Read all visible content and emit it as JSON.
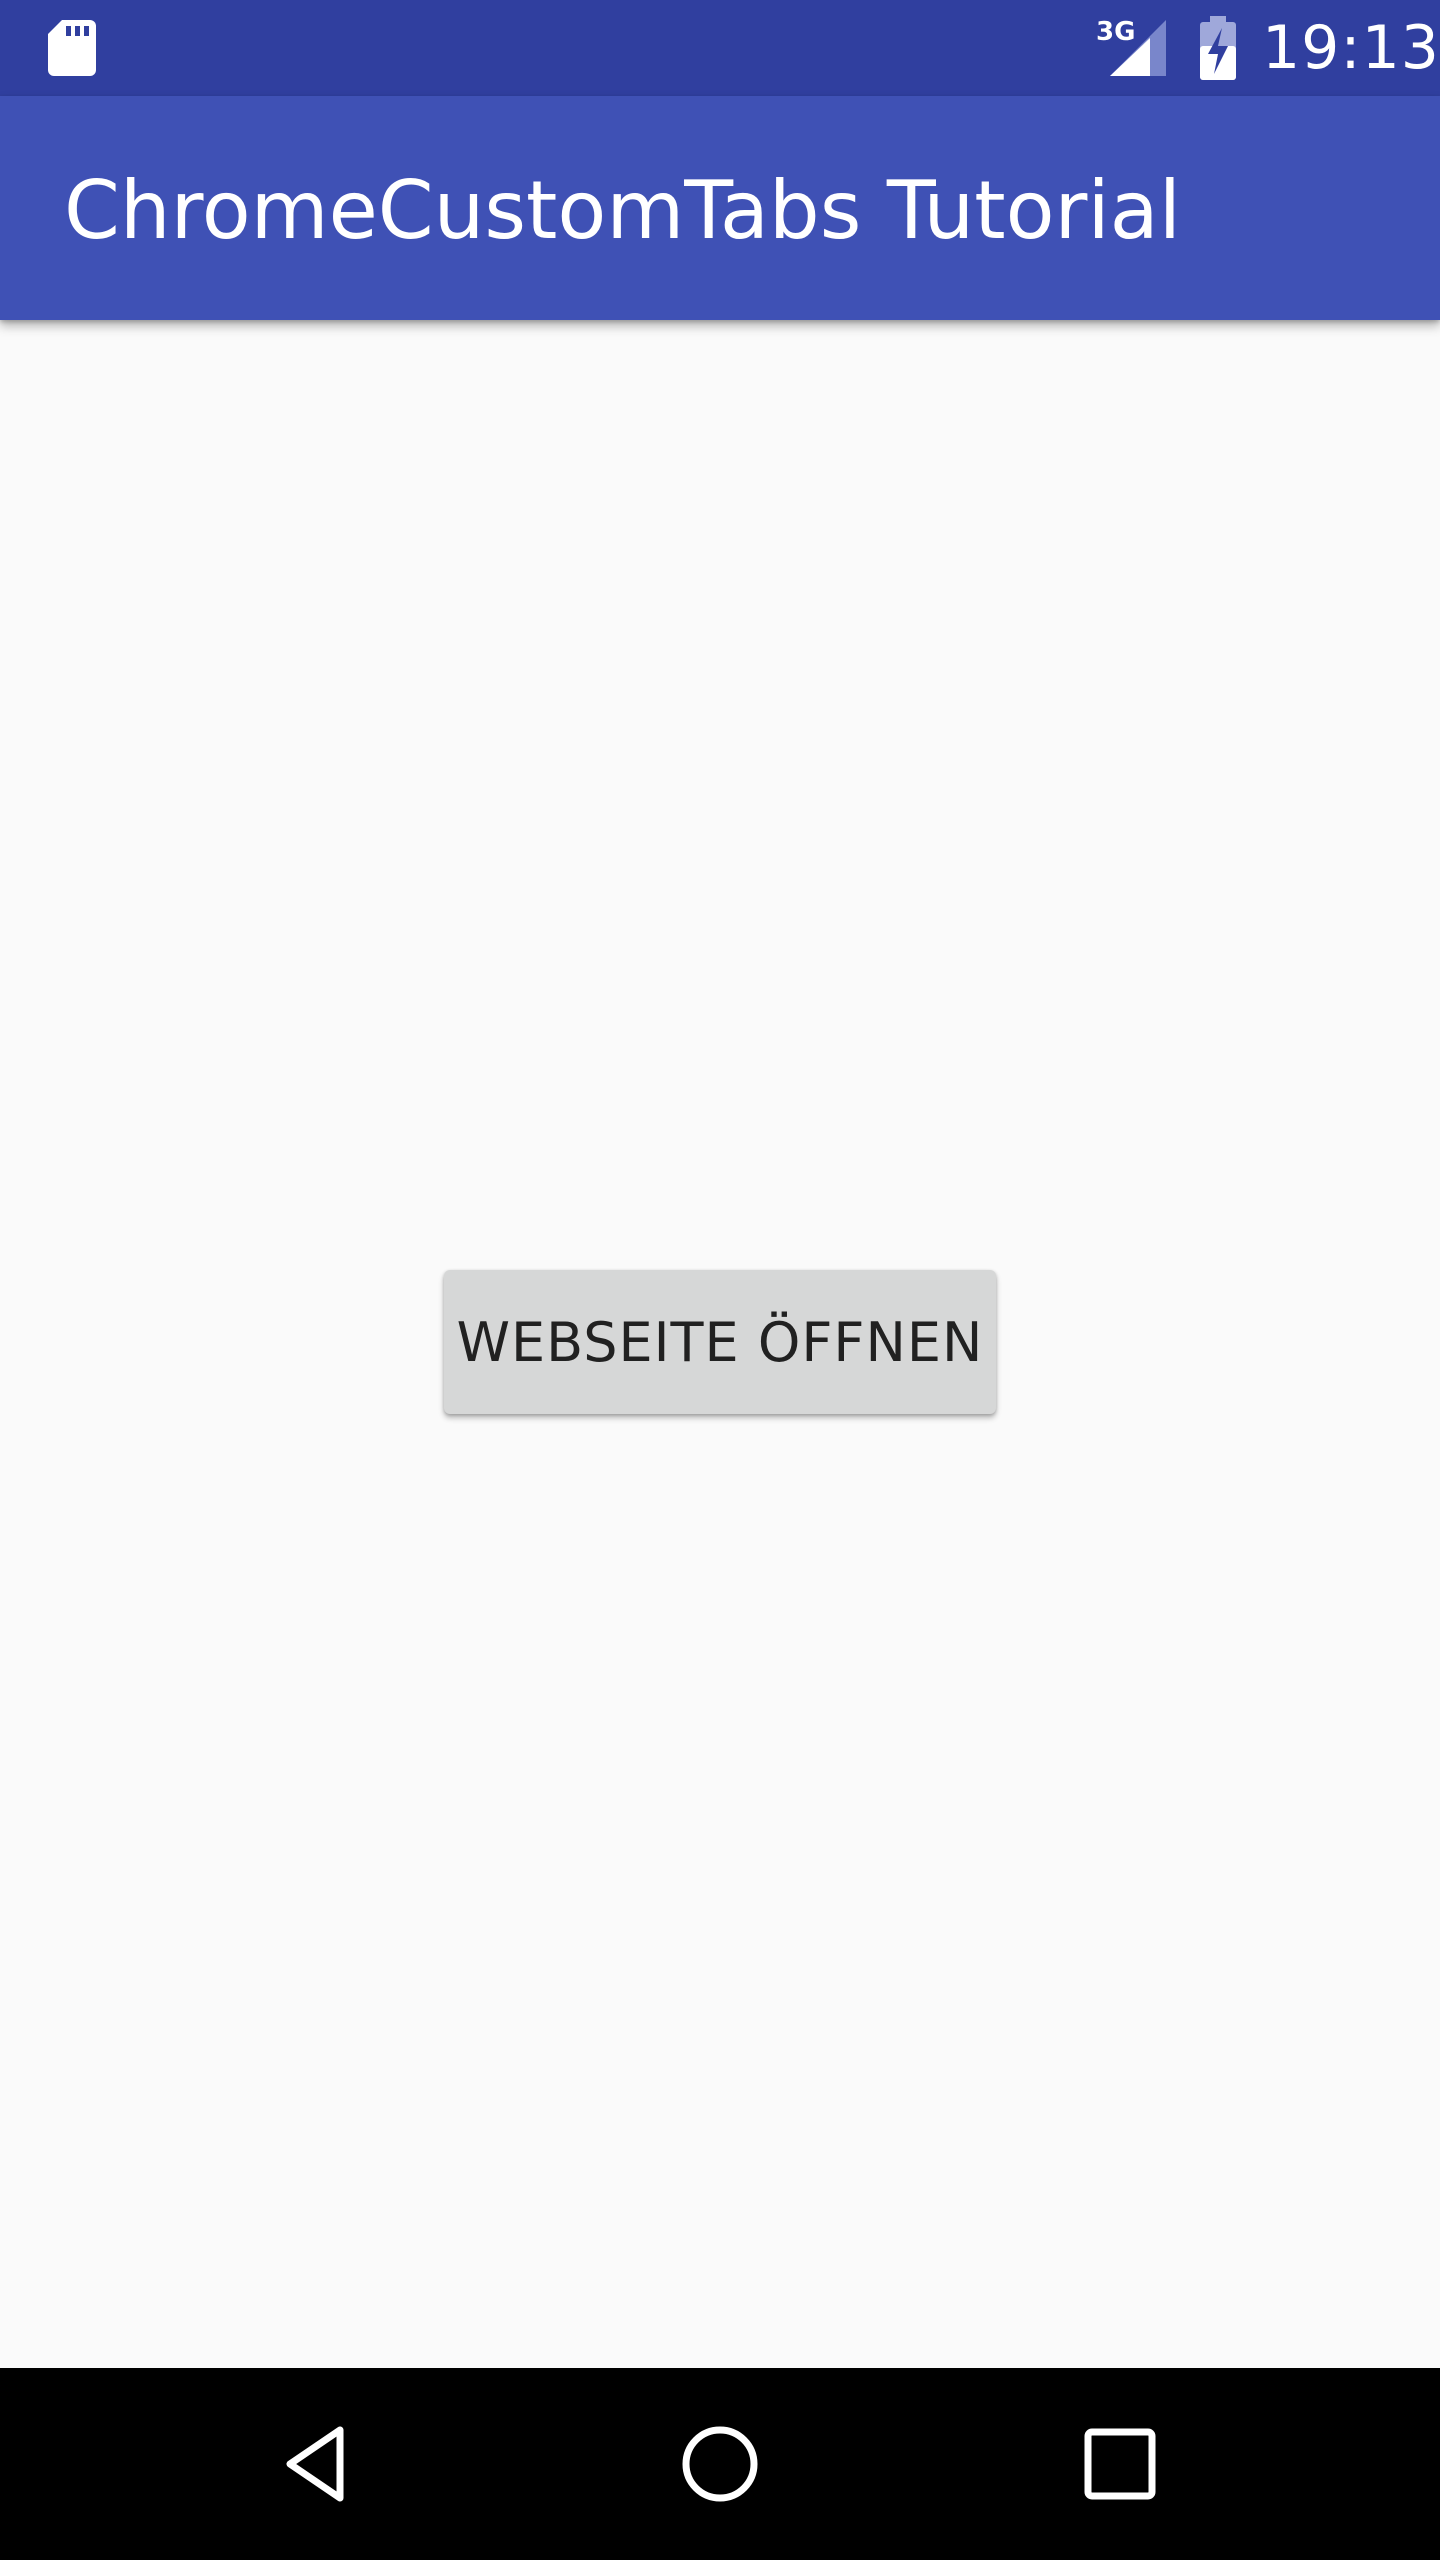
{
  "status_bar": {
    "time": "19:13",
    "network_type": "3G",
    "background_color": "#303f9f",
    "icons": [
      "sd-card-icon",
      "signal-icon",
      "battery-charging-icon"
    ]
  },
  "app_bar": {
    "title": "ChromeCustomTabs Tutorial",
    "background_color": "#3f51b5"
  },
  "main": {
    "open_button_label": "WEBSEITE ÖFFNEN",
    "background_color": "#fafafa",
    "button_color": "#d6d7d7"
  },
  "nav_bar": {
    "icons": [
      "back-icon",
      "home-icon",
      "recents-icon"
    ],
    "background_color": "#000000"
  }
}
